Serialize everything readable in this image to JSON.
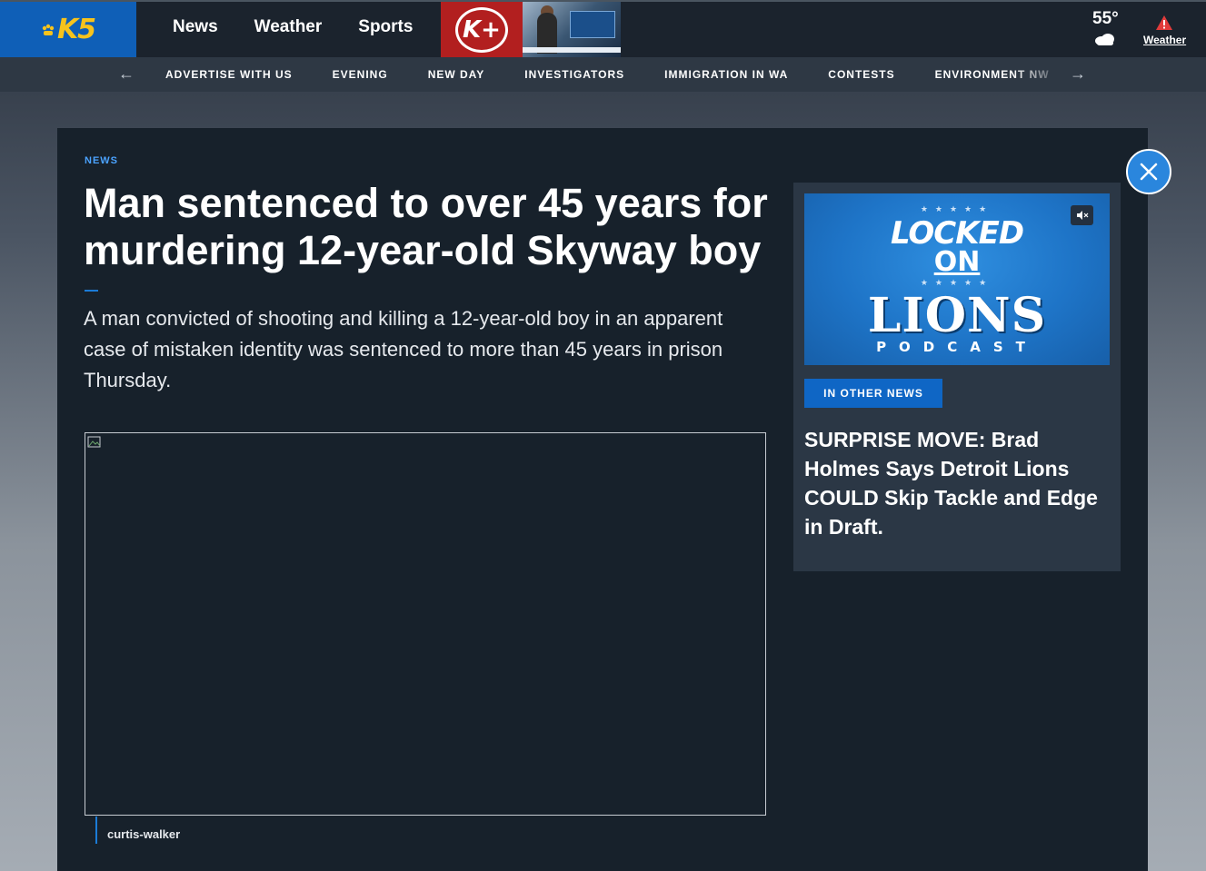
{
  "header": {
    "logo_text": "K5",
    "nav": [
      "News",
      "Weather",
      "Sports"
    ],
    "promo_icon": "k-plus-logo",
    "weather": {
      "temperature": "55°",
      "link_label": "Weather",
      "icons": [
        "cloud-icon",
        "alert-icon"
      ]
    }
  },
  "subnav": {
    "items": [
      "ADVERTISE WITH US",
      "EVENING",
      "NEW DAY",
      "INVESTIGATORS",
      "IMMIGRATION IN WA",
      "CONTESTS",
      "ENVIRONMENT NW"
    ],
    "icons": [
      "arrow-left-icon",
      "arrow-right-icon"
    ]
  },
  "article": {
    "kicker": "NEWS",
    "headline": "Man sentenced to over 45 years for murdering 12-year-old Skyway boy",
    "dek": "A man convicted of shooting and killing a 12-year-old boy in an apparent case of mistaken identity was sentenced to more than 45 years in prison Thursday.",
    "image_caption": "curtis-walker"
  },
  "sidebar": {
    "video": {
      "locked": "LOCKED",
      "on": "ON",
      "lions": "LIONS",
      "podcast": "PODCAST"
    },
    "tag": "IN OTHER NEWS",
    "headline": "SURPRISE MOVE: Brad Holmes Says Detroit Lions COULD Skip Tackle and Edge in Draft."
  },
  "colors": {
    "brand_blue": "#0f5fb7",
    "accent_blue": "#1b7bd6",
    "kicker_blue": "#4ba3ff",
    "kplus_red": "#b21f1f",
    "panel_bg": "#17212b",
    "logo_yellow": "#f7c31c"
  }
}
